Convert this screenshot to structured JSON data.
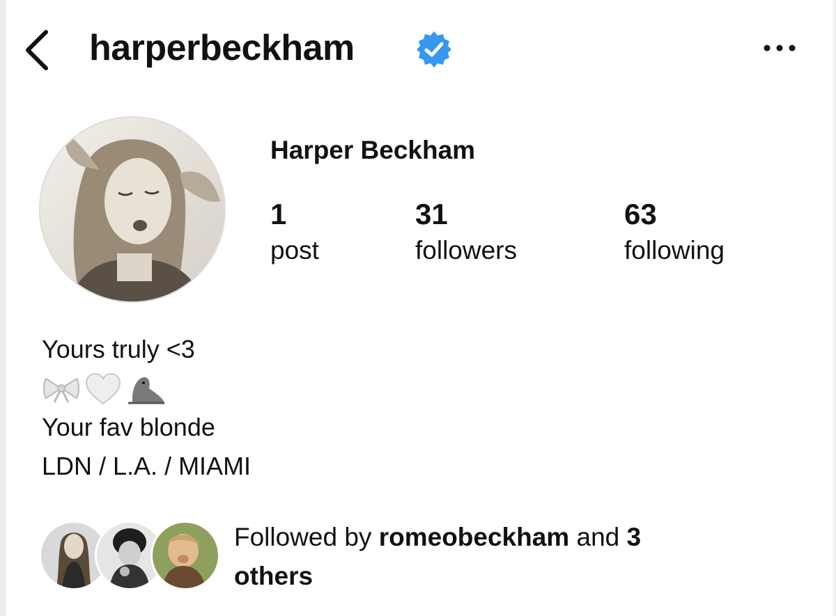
{
  "header": {
    "back_icon": "chevron-left-icon",
    "username": "harperbeckham",
    "verified_icon": "verified-badge-icon",
    "verified_color": "#3897f0",
    "more_icon": "more-horizontal-icon"
  },
  "profile": {
    "full_name": "Harper Beckham",
    "stats": {
      "posts": {
        "count": "1",
        "label": "post"
      },
      "followers": {
        "count": "31",
        "label": "followers"
      },
      "following": {
        "count": "63",
        "label": "following"
      }
    },
    "bio": {
      "line1": "Yours truly <3",
      "emojis": [
        "bow-emoji",
        "white-heart-emoji",
        "seal-emoji"
      ],
      "line3": "Your fav blonde",
      "line4": "LDN / L.A. / MIAMI"
    }
  },
  "followed_by": {
    "prefix": "Followed by",
    "user": "romeobeckham",
    "middle": "and",
    "count": "3",
    "suffix": "others"
  }
}
